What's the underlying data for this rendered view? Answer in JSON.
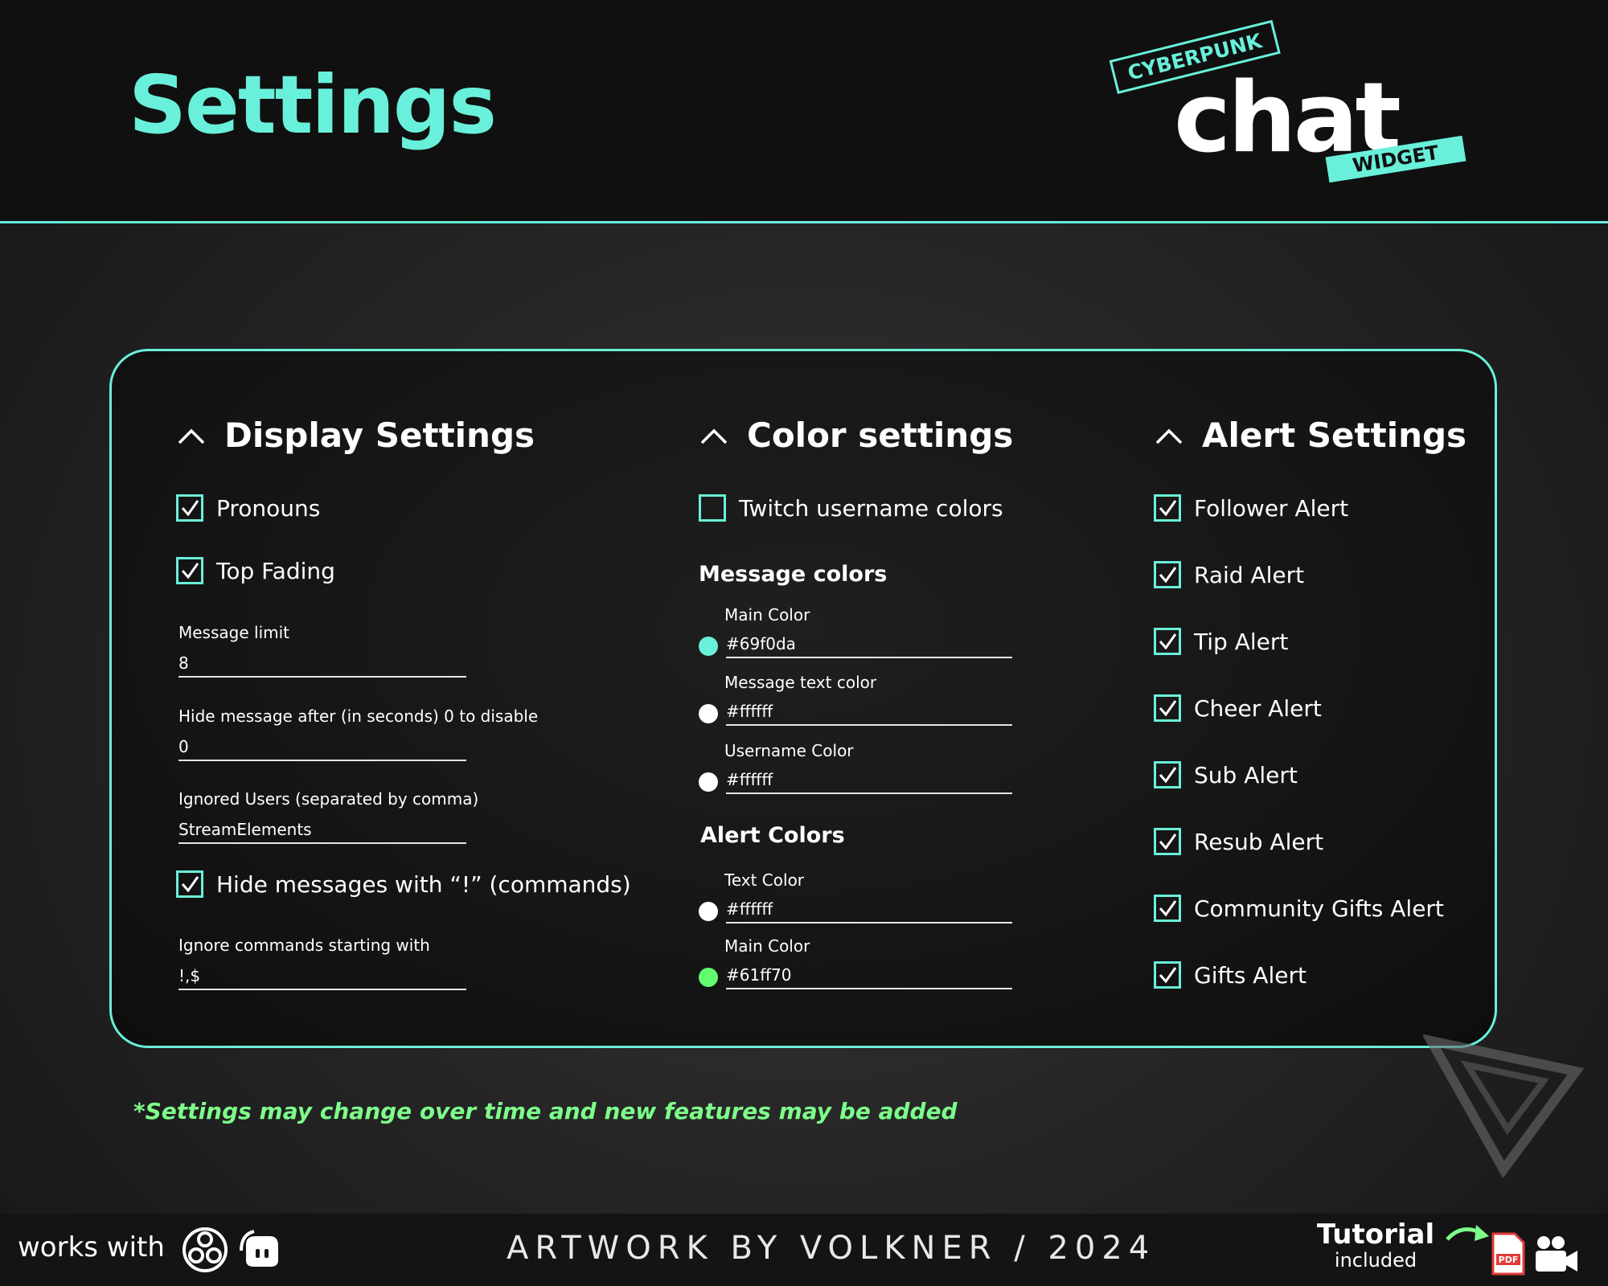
{
  "header": {
    "title": "Settings",
    "logo": {
      "cyber": "CYBERPUNK",
      "chat": "chat",
      "widget": "WIDGET"
    }
  },
  "display": {
    "title": "Display Settings",
    "pronouns": "Pronouns",
    "top_fading": "Top Fading",
    "message_limit": {
      "label": "Message limit",
      "value": "8"
    },
    "hide_after": {
      "label": "Hide message after (in seconds) 0 to disable",
      "value": "0"
    },
    "ignored_users": {
      "label": "Ignored Users (separated by comma)",
      "value": "StreamElements"
    },
    "hide_commands": "Hide messages with “!” (commands)",
    "ignore_prefix": {
      "label": "Ignore commands starting with",
      "value": "!,$"
    }
  },
  "color": {
    "title": "Color settings",
    "twitch_colors": "Twitch username colors",
    "message_colors": "Message colors",
    "main_color": {
      "label": "Main Color",
      "value": "#69f0da"
    },
    "text_color": {
      "label": "Message text color",
      "value": "#ffffff"
    },
    "username_color": {
      "label": "Username Color",
      "value": "#ffffff"
    },
    "alert_colors": "Alert Colors",
    "alert_text_color": {
      "label": "Text Color",
      "value": "#ffffff"
    },
    "alert_main_color": {
      "label": "Main Color",
      "value": "#61ff70"
    }
  },
  "alerts": {
    "title": "Alert Settings",
    "items": [
      "Follower Alert",
      "Raid Alert",
      "Tip Alert",
      "Cheer Alert",
      "Sub Alert",
      "Resub Alert",
      "Community Gifts Alert",
      "Gifts Alert"
    ]
  },
  "footnote": "*Settings may change over time and new features may be added",
  "footer": {
    "works_with": "works with",
    "credit": "ARTWORK BY VOLKNER / 2024",
    "tutorial": "Tutorial",
    "included": "included",
    "pdf_label": "PDF"
  },
  "colors": {
    "accent": "#69f0da",
    "green": "#61ff70",
    "footnote": "#7dff8a"
  }
}
